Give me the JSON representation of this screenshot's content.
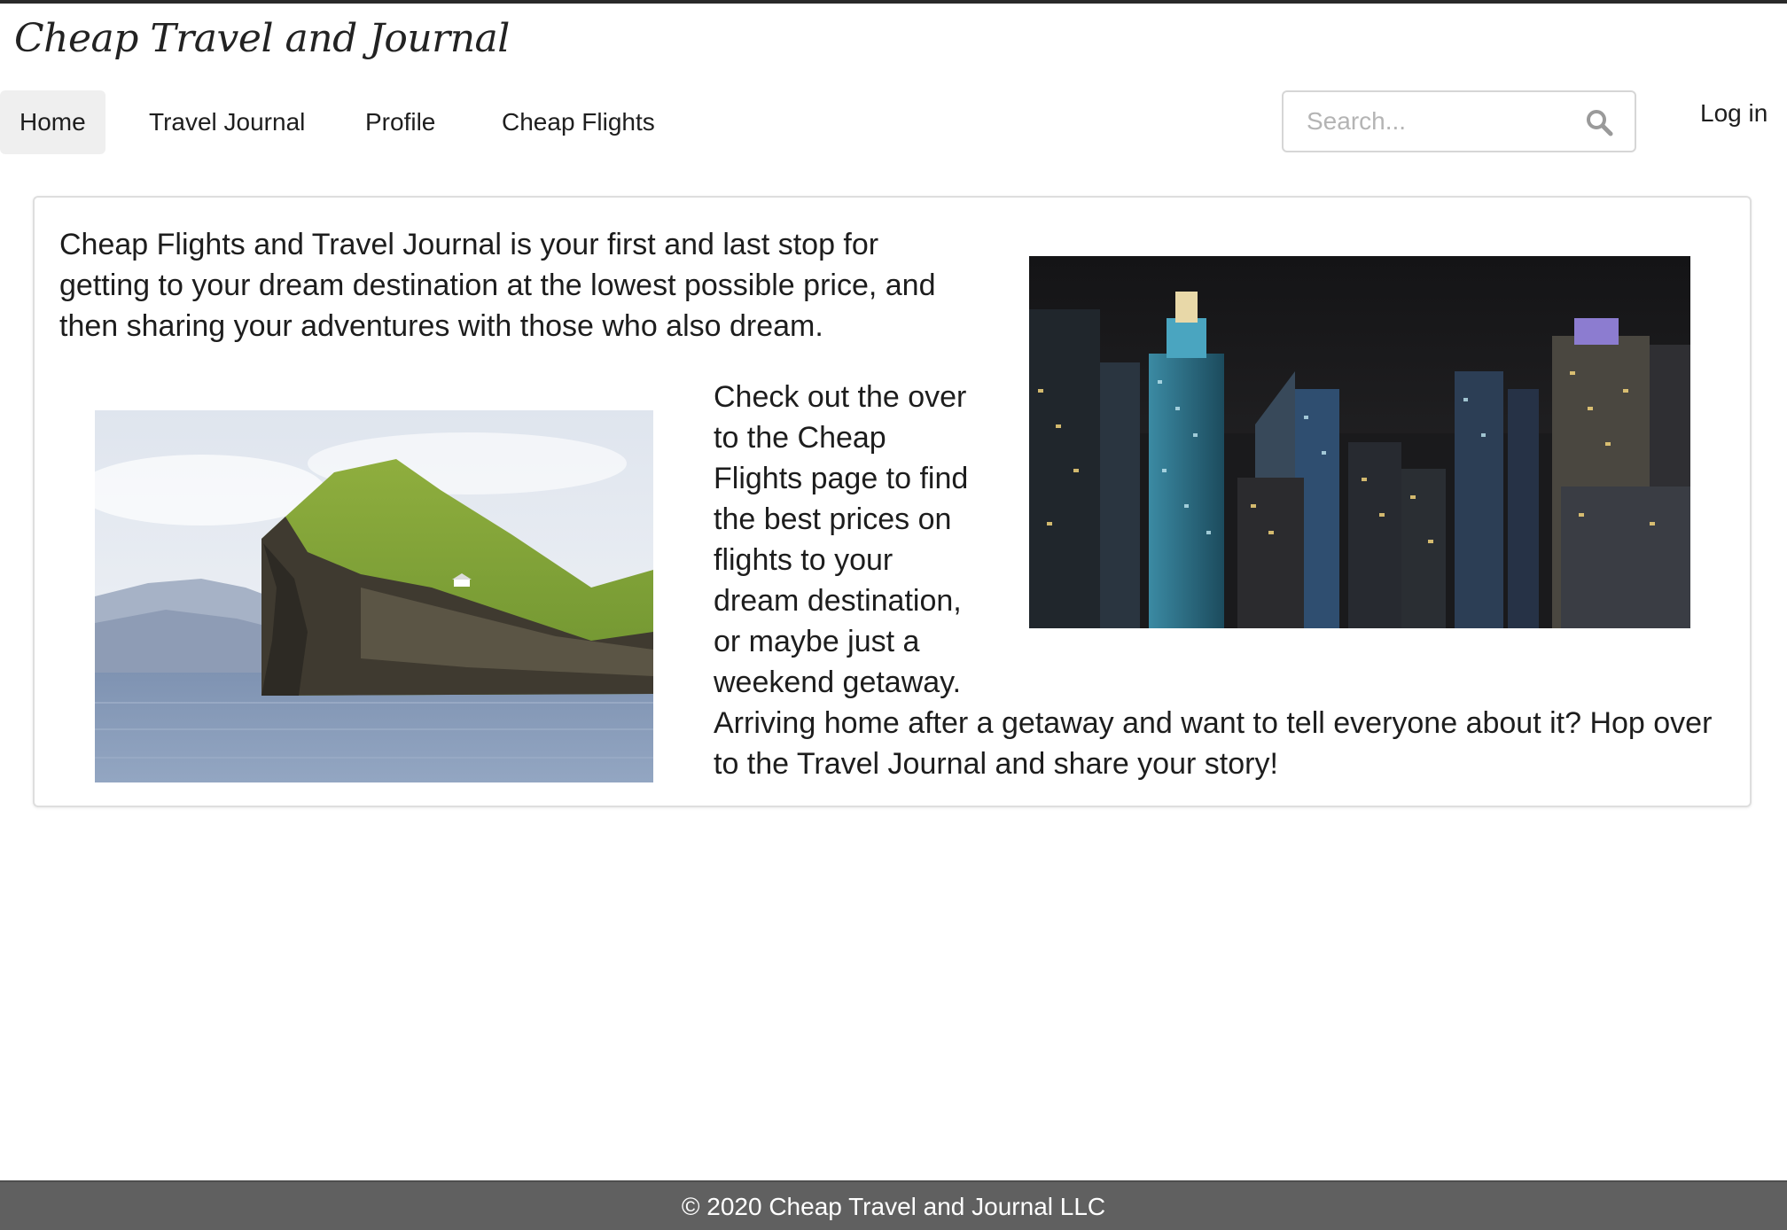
{
  "site": {
    "title": "Cheap Travel and Journal"
  },
  "nav": {
    "items": [
      {
        "label": "Home",
        "active": true
      },
      {
        "label": "Travel Journal",
        "active": false
      },
      {
        "label": "Profile",
        "active": false
      },
      {
        "label": "Cheap Flights",
        "active": false
      }
    ]
  },
  "search": {
    "placeholder": "Search...",
    "icon": "search-icon"
  },
  "auth": {
    "login_label": "Log in"
  },
  "main": {
    "intro_text": "Cheap Flights and Travel Journal is your first and last stop for getting to your dream destination at the lowest possible price, and then sharing your adventures with those who also dream.",
    "side_text": "Check out the over to the Cheap Flights page to find the best prices on flights to your dream destination, or maybe just a weekend getaway.",
    "bottom_text": "Arriving home after a getaway and want to tell everyone about it? Hop over to the Travel Journal and share your story!"
  },
  "footer": {
    "copyright": "© 2020 Cheap Travel and Journal LLC"
  },
  "colors": {
    "footer_bg": "#606060",
    "nav_active_bg": "#efefef",
    "text": "#1d1d1d"
  }
}
